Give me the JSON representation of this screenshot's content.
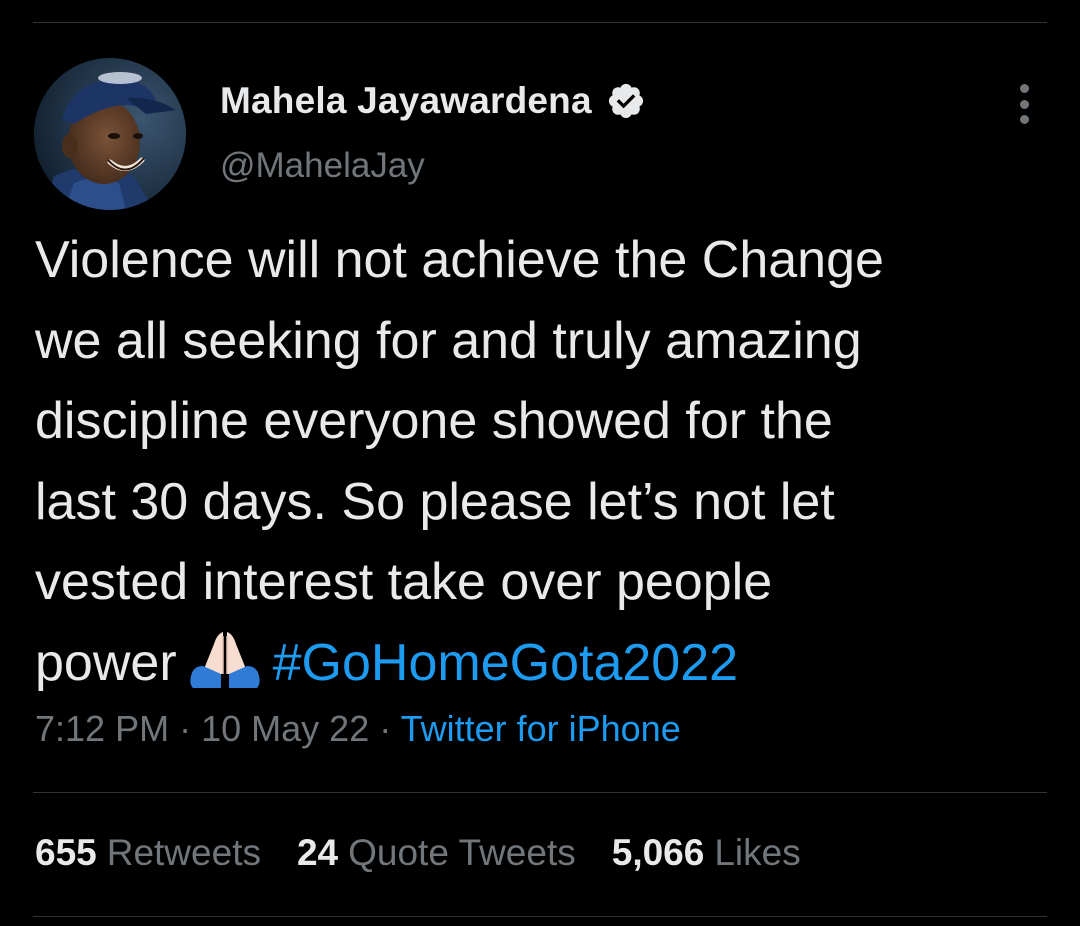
{
  "author": {
    "display_name": "Mahela Jayawardena",
    "handle": "@MahelaJay",
    "verified": true,
    "avatar_icon": "profile-photo"
  },
  "tweet": {
    "lines": [
      "Violence will not achieve the Change",
      "we all seeking for and truly amazing",
      "discipline everyone showed for the",
      "last 30 days. So please let’s not let",
      "vested interest take over people"
    ],
    "last_line_text": "power",
    "emoji": "🙏🏻",
    "hashtag": "#GoHomeGota2022"
  },
  "meta": {
    "time": "7:12 PM",
    "date": "10 May 22",
    "separator": "·",
    "source": "Twitter for iPhone"
  },
  "stats": [
    {
      "count": "655",
      "label": "Retweets"
    },
    {
      "count": "24",
      "label": "Quote Tweets"
    },
    {
      "count": "5,066",
      "label": "Likes"
    }
  ],
  "colors": {
    "background": "#000000",
    "text": "#e7e9ea",
    "secondary": "#71767b",
    "accent": "#1d9bf0",
    "divider": "#2f3336"
  }
}
